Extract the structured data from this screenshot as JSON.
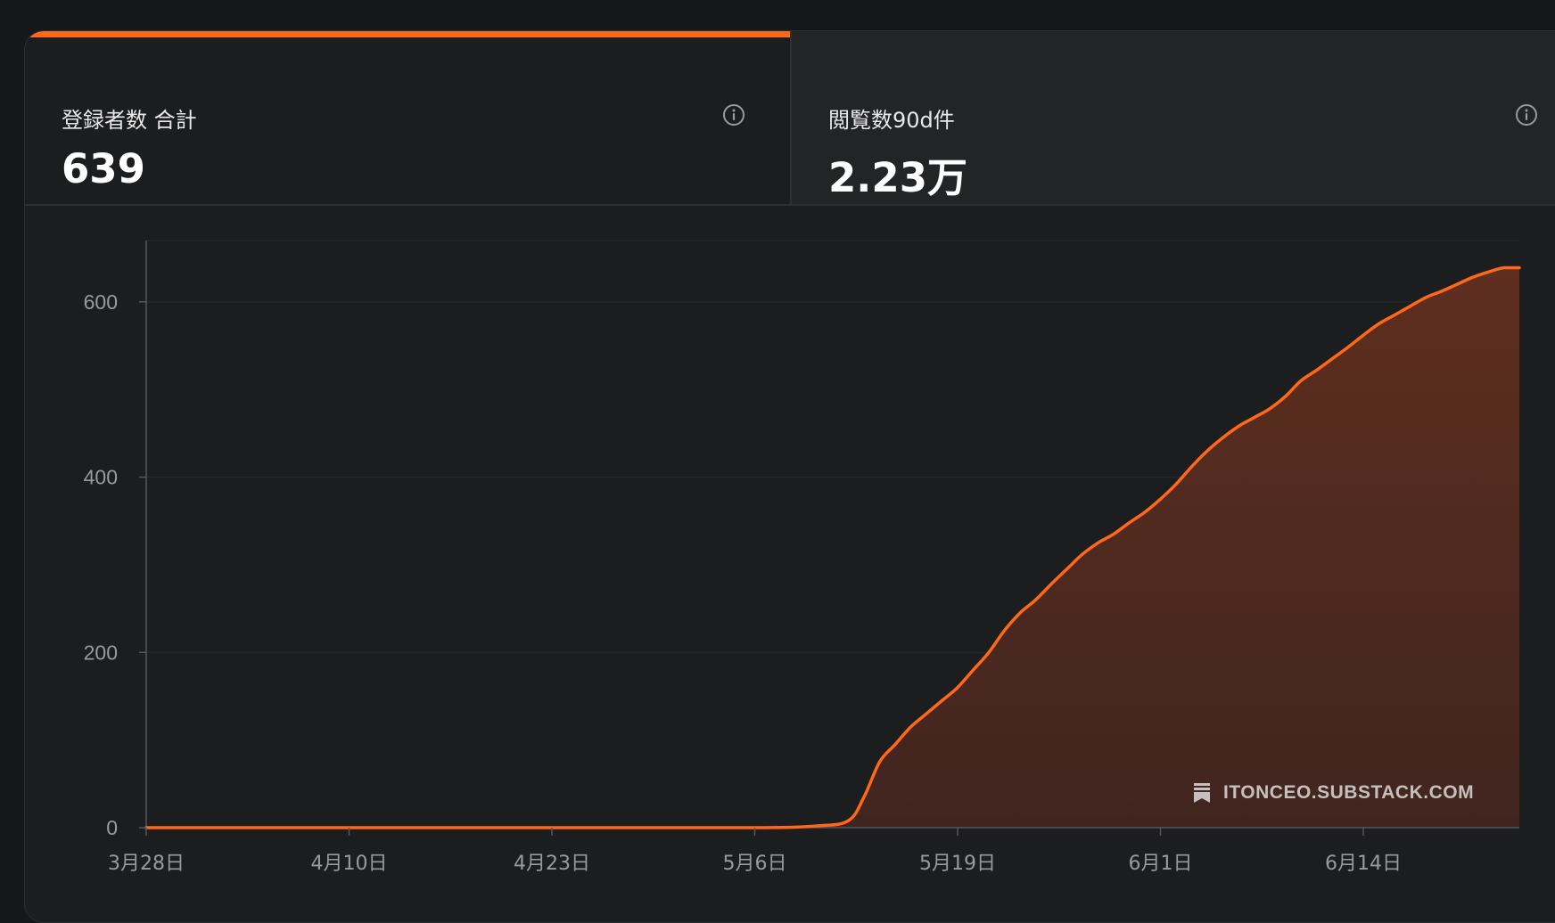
{
  "tabs": [
    {
      "label": "登録者数 合計",
      "value": "639",
      "active": true
    },
    {
      "label": "閲覧数90d件",
      "value": "2.23万",
      "active": false
    }
  ],
  "icons": {
    "info": "info-icon",
    "watermark": "bookmark-icon"
  },
  "watermark": "ITONCEO.SUBSTACK.COM",
  "colors": {
    "accent": "#ff6719",
    "area_fill": "#5a2d20",
    "background": "#1c1d1f",
    "grid": "#2a2b2e",
    "axis_text": "#9a9a9a"
  },
  "chart_data": {
    "type": "area",
    "x_labels": [
      "3月28日",
      "4月10日",
      "4月23日",
      "5月6日",
      "5月19日",
      "6月1日",
      "6月14日"
    ],
    "y_ticks": [
      0,
      200,
      400,
      600
    ],
    "ylim": [
      0,
      670
    ],
    "xlim": [
      "3月28日",
      "6月24日"
    ],
    "grid": true,
    "series": [
      {
        "x": [
          "3月28日",
          "4月10日",
          "4月23日",
          "5月6日",
          "5月10日",
          "5月12日",
          "5月13日",
          "5月14日",
          "5月15日",
          "5月16日",
          "5月17日",
          "5月18日",
          "5月19日",
          "5月20日",
          "5月21日",
          "5月22日",
          "5月23日",
          "5月24日",
          "5月25日",
          "5月26日",
          "5月27日",
          "5月28日",
          "5月29日",
          "5月30日",
          "5月31日",
          "6月1日",
          "6月2日",
          "6月3日",
          "6月4日",
          "6月5日",
          "6月6日",
          "6月7日",
          "6月8日",
          "6月9日",
          "6月10日",
          "6月11日",
          "6月12日",
          "6月13日",
          "6月14日",
          "6月15日",
          "6月16日",
          "6月17日",
          "6月18日",
          "6月19日",
          "6月20日",
          "6月21日",
          "6月22日",
          "6月23日",
          "6月24日"
        ],
        "y": [
          0,
          0,
          0,
          0,
          2,
          8,
          35,
          75,
          95,
          115,
          130,
          145,
          160,
          180,
          200,
          225,
          245,
          260,
          278,
          295,
          312,
          325,
          335,
          348,
          360,
          375,
          392,
          412,
          430,
          445,
          458,
          468,
          478,
          492,
          510,
          522,
          535,
          548,
          562,
          575,
          585,
          595,
          605,
          612,
          620,
          628,
          634,
          639,
          639
        ]
      }
    ]
  }
}
